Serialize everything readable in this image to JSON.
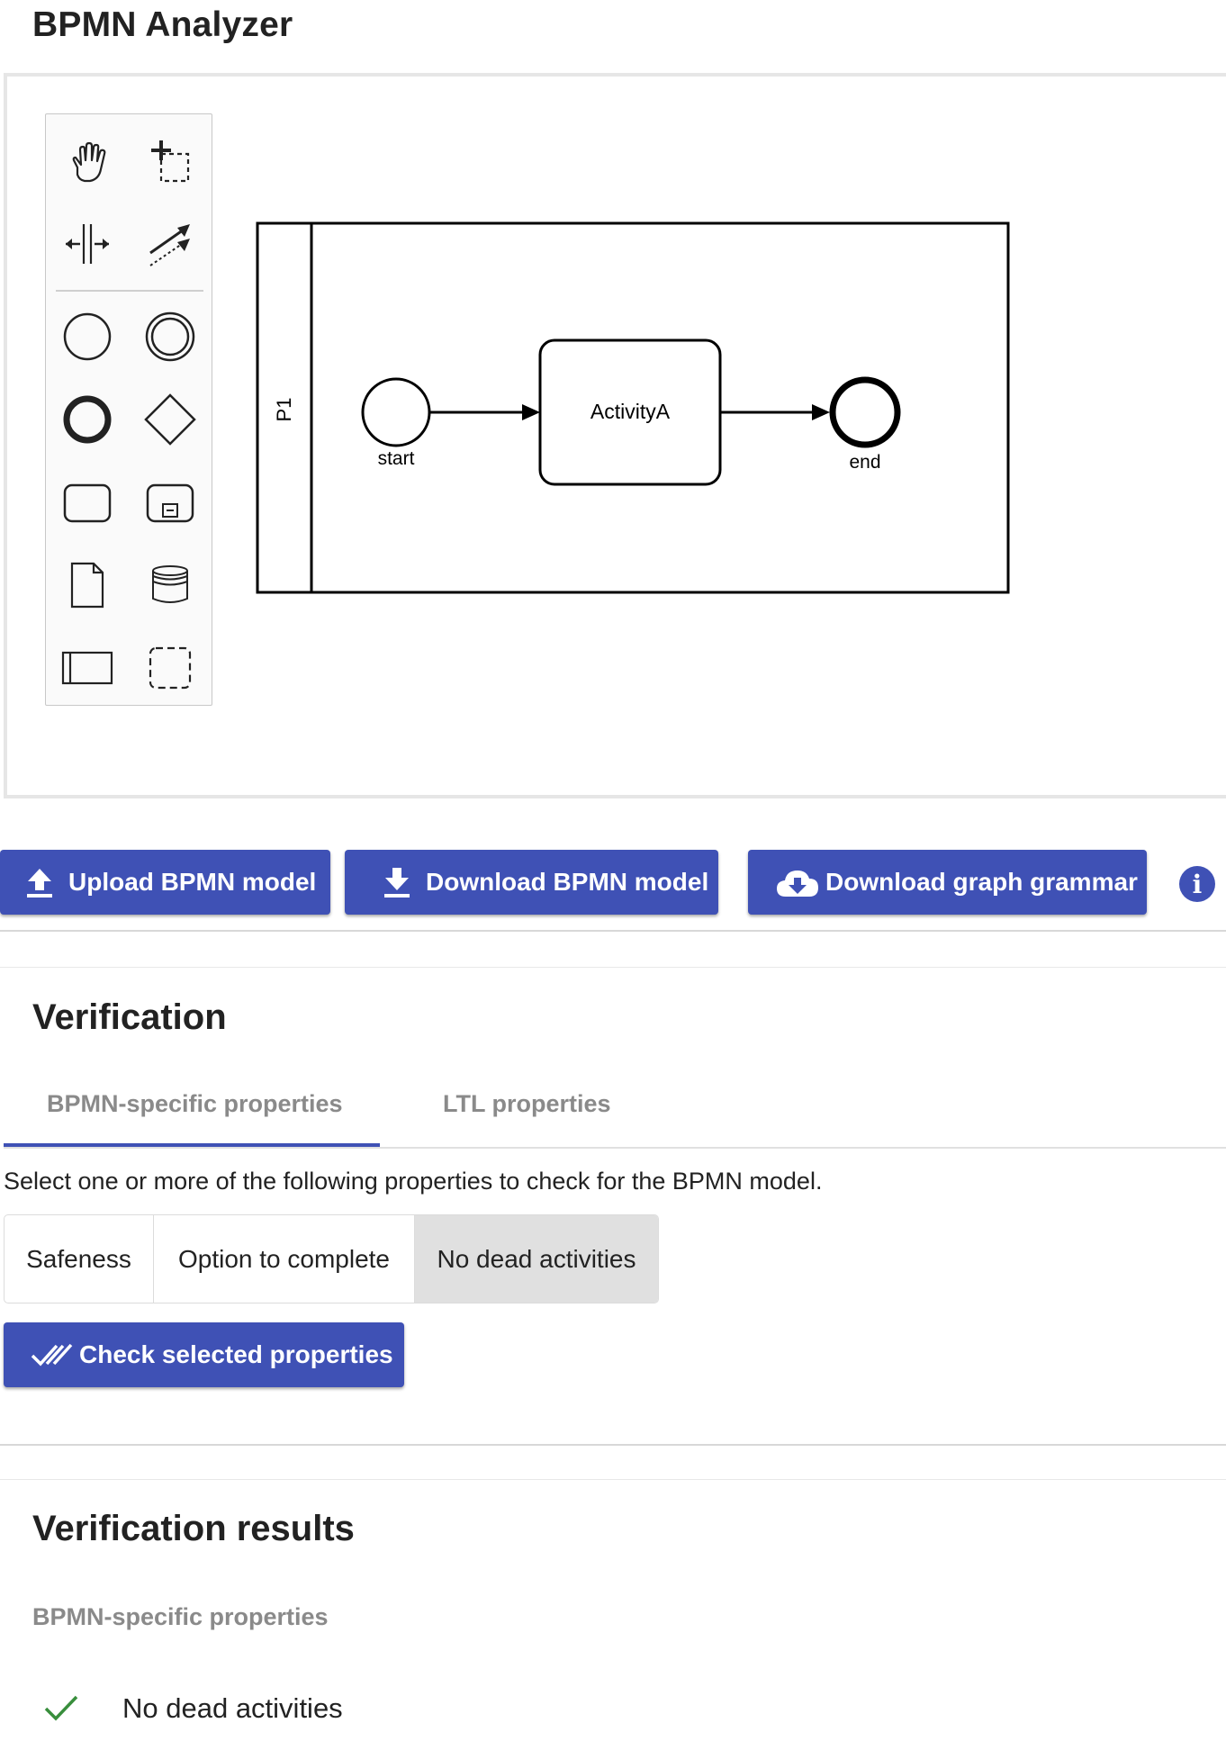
{
  "app": {
    "title": "BPMN Analyzer"
  },
  "palette": {
    "tools": [
      {
        "name": "hand-tool-icon"
      },
      {
        "name": "lasso-tool-icon"
      },
      {
        "name": "space-tool-icon"
      },
      {
        "name": "global-connect-tool-icon"
      },
      {
        "name": "start-event-icon"
      },
      {
        "name": "intermediate-event-icon"
      },
      {
        "name": "end-event-icon"
      },
      {
        "name": "gateway-icon"
      },
      {
        "name": "task-icon"
      },
      {
        "name": "subprocess-icon"
      },
      {
        "name": "data-object-icon"
      },
      {
        "name": "data-store-icon"
      },
      {
        "name": "participant-icon"
      },
      {
        "name": "group-icon"
      }
    ]
  },
  "diagram": {
    "pool_label": "P1",
    "start_label": "start",
    "task_label": "ActivityA",
    "end_label": "end"
  },
  "toolbar": {
    "upload_label": "Upload BPMN model",
    "download_label": "Download BPMN model",
    "grammar_label": "Download graph grammar",
    "info_label": "i"
  },
  "verification": {
    "title": "Verification",
    "tabs": [
      {
        "label": "BPMN-specific properties",
        "active": true
      },
      {
        "label": "LTL properties",
        "active": false
      }
    ],
    "description": "Select one or more of the following properties to check for the BPMN model.",
    "properties": [
      {
        "label": "Safeness",
        "selected": false
      },
      {
        "label": "Option to complete",
        "selected": false
      },
      {
        "label": "No dead activities",
        "selected": true
      }
    ],
    "check_label": "Check selected properties"
  },
  "results": {
    "title": "Verification results",
    "subtitle": "BPMN-specific properties",
    "items": [
      {
        "label": "No dead activities",
        "status": "passed"
      }
    ]
  },
  "colors": {
    "primary": "#3f51b5",
    "success": "#388e3c",
    "selected_toggle": "#e0e0e0"
  }
}
